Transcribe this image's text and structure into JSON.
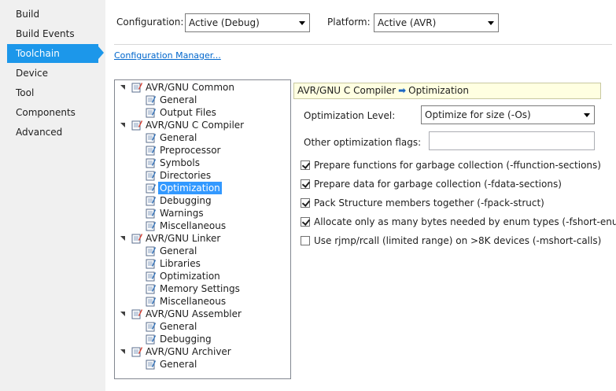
{
  "sidebar": {
    "items": [
      {
        "label": "Build"
      },
      {
        "label": "Build Events"
      },
      {
        "label": "Toolchain"
      },
      {
        "label": "Device"
      },
      {
        "label": "Tool"
      },
      {
        "label": "Components"
      },
      {
        "label": "Advanced"
      }
    ],
    "active": "Toolchain",
    "accent": "#1c97ea"
  },
  "header": {
    "configuration_label": "Configuration:",
    "configuration_value": "Active (Debug)",
    "platform_label": "Platform:",
    "platform_value": "Active (AVR)",
    "config_manager_link": "Configuration Manager..."
  },
  "tree": {
    "groups": [
      {
        "label": "AVR/GNU Common",
        "children": [
          "General",
          "Output Files"
        ]
      },
      {
        "label": "AVR/GNU C Compiler",
        "children": [
          "General",
          "Preprocessor",
          "Symbols",
          "Directories",
          "Optimization",
          "Debugging",
          "Warnings",
          "Miscellaneous"
        ]
      },
      {
        "label": "AVR/GNU Linker",
        "children": [
          "General",
          "Libraries",
          "Optimization",
          "Memory Settings",
          "Miscellaneous"
        ]
      },
      {
        "label": "AVR/GNU Assembler",
        "children": [
          "General",
          "Debugging"
        ]
      },
      {
        "label": "AVR/GNU Archiver",
        "children": [
          "General"
        ]
      }
    ],
    "selected": "AVR/GNU C Compiler > Optimization",
    "selection_color": "#3399ff"
  },
  "panel": {
    "breadcrumb_parent": "AVR/GNU C Compiler",
    "breadcrumb_arrow": "➡",
    "breadcrumb_child": "Optimization",
    "opt_level_label": "Optimization Level:",
    "opt_level_value": "Optimize for size (-Os)",
    "other_flags_label": "Other optimization flags:",
    "other_flags_value": "",
    "checkboxes": [
      {
        "label": "Prepare functions for garbage collection (-ffunction-sections)",
        "checked": true
      },
      {
        "label": "Prepare data for garbage collection (-fdata-sections)",
        "checked": true
      },
      {
        "label": "Pack Structure members together (-fpack-struct)",
        "checked": true
      },
      {
        "label": "Allocate only as many bytes needed by enum types (-fshort-enums)",
        "checked": true
      },
      {
        "label": "Use rjmp/rcall (limited range) on >8K devices (-mshort-calls)",
        "checked": false
      }
    ]
  }
}
